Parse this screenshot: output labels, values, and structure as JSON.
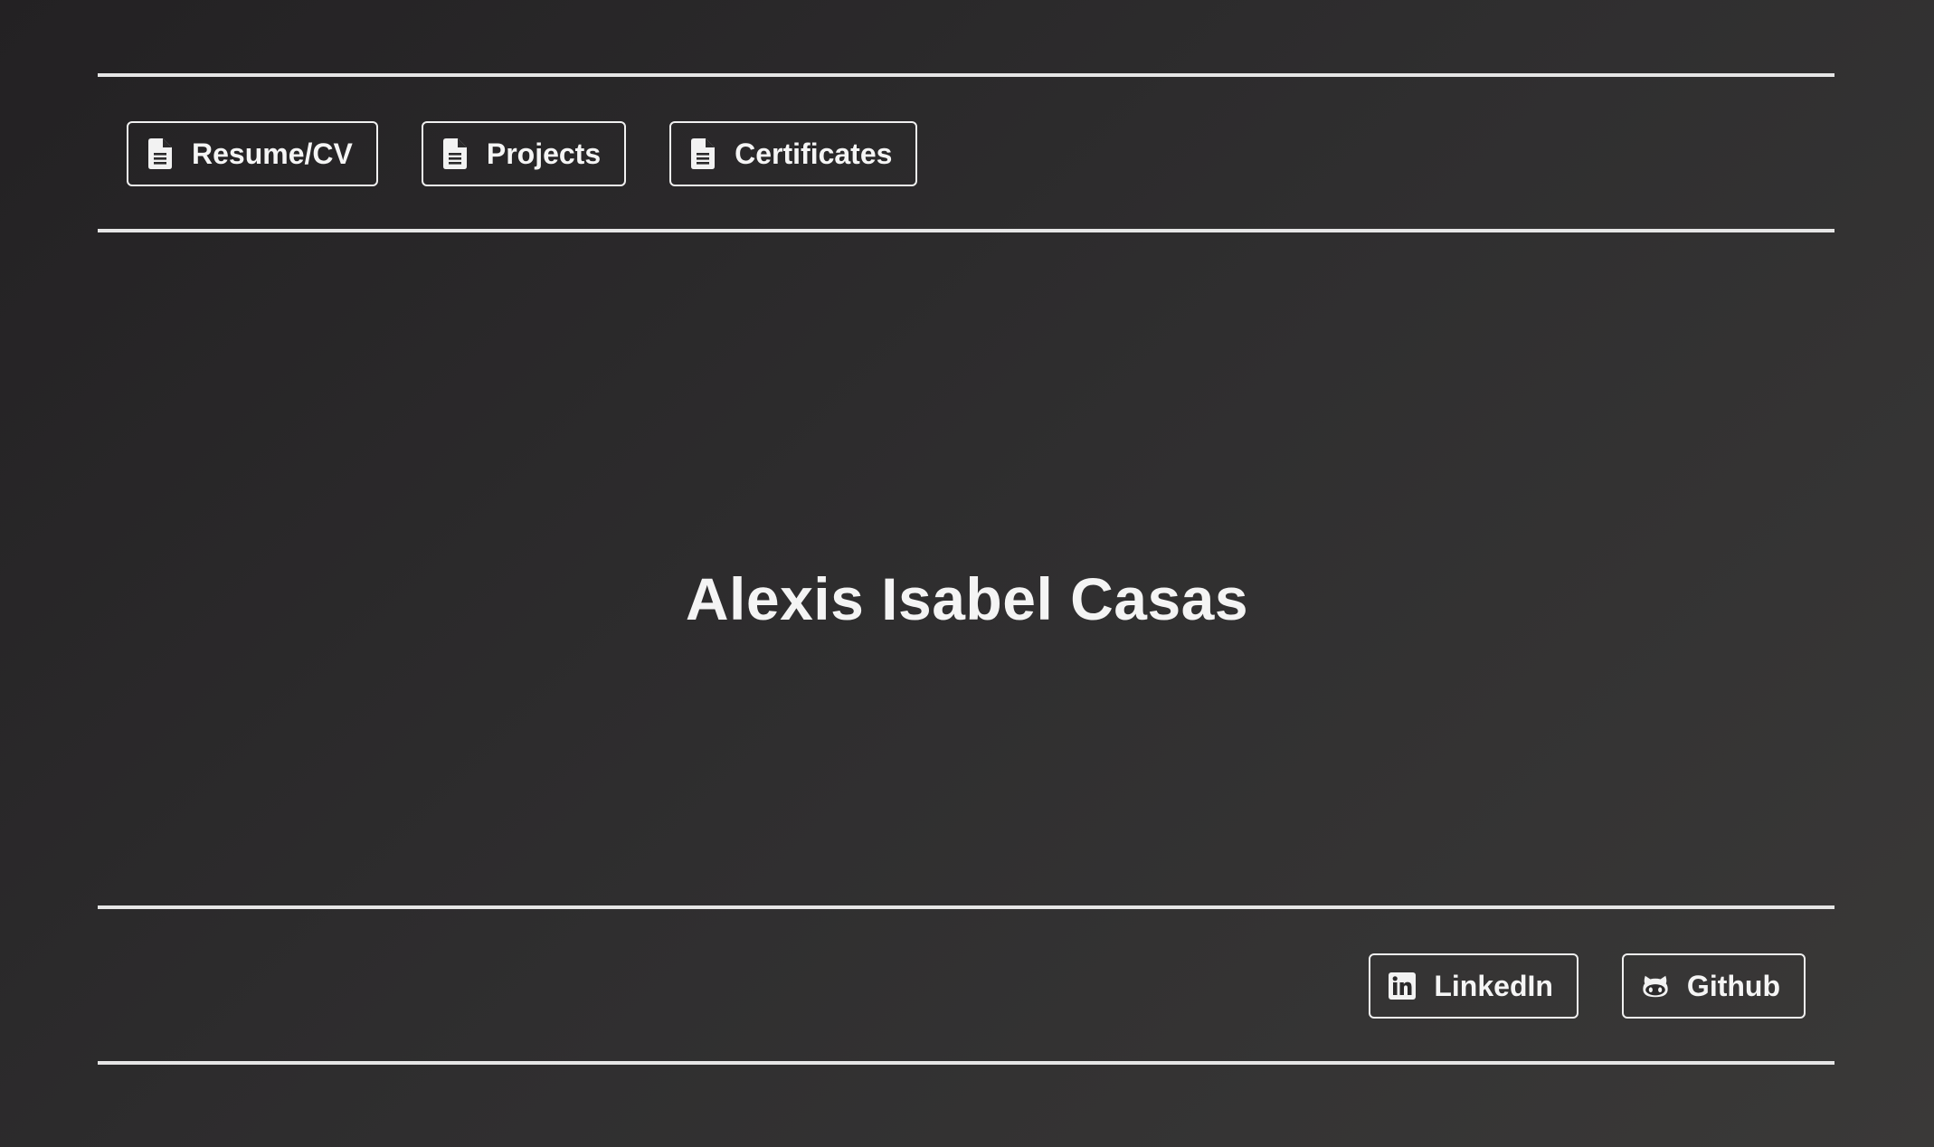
{
  "nav": {
    "items": [
      {
        "label": "Resume/CV",
        "icon": "document-icon"
      },
      {
        "label": "Projects",
        "icon": "document-icon"
      },
      {
        "label": "Certificates",
        "icon": "document-icon"
      }
    ]
  },
  "hero": {
    "name": "Alexis Isabel Casas"
  },
  "footer": {
    "links": [
      {
        "label": "LinkedIn",
        "icon": "linkedin-icon"
      },
      {
        "label": "Github",
        "icon": "github-icon"
      }
    ]
  },
  "colors": {
    "background_start": "#232123",
    "background_end": "#3a3938",
    "foreground": "#f2f2f2"
  }
}
